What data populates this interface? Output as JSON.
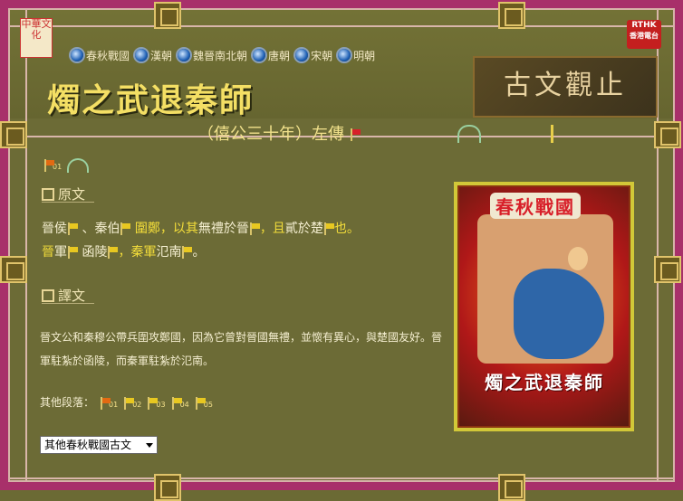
{
  "header": {
    "logo_left_text": "中華文化",
    "rthk_label": "RTHK",
    "rthk_sub": "香港電台",
    "seal_text": "古文觀止"
  },
  "nav": {
    "items": [
      {
        "label": "春秋戰國"
      },
      {
        "label": "漢朝"
      },
      {
        "label": "魏晉南北朝"
      },
      {
        "label": "唐朝"
      },
      {
        "label": "宋朝"
      },
      {
        "label": "明朝"
      }
    ]
  },
  "page": {
    "title": "燭之武退秦師",
    "subtitle": "（僖公三十年）左傳"
  },
  "audio": {
    "clip_label": "01"
  },
  "sections": {
    "original_label": "原文",
    "translation_label": "譯文"
  },
  "original_text": {
    "line1": [
      {
        "text": "晉侯",
        "hl": false
      },
      {
        "text": "、秦伯",
        "hl": false
      },
      {
        "text": "圍鄭",
        "hl": true
      },
      {
        "text": "，以其",
        "hl": true
      },
      {
        "text": "無禮於晉",
        "hl": false
      },
      {
        "text": "，且",
        "hl": true
      },
      {
        "text": "貳於楚",
        "hl": false
      },
      {
        "text": "也。",
        "hl": true
      }
    ],
    "line2": [
      {
        "text": "晉",
        "hl": true
      },
      {
        "text": "軍",
        "hl": false
      },
      {
        "text": "函陵",
        "hl": false
      },
      {
        "text": "，秦",
        "hl": true
      },
      {
        "text": "軍",
        "hl": true
      },
      {
        "text": "氾南",
        "hl": false
      },
      {
        "text": "。",
        "hl": false
      }
    ]
  },
  "translation": {
    "text": "晉文公和秦穆公帶兵圍攻鄭國，因為它曾對晉國無禮，並懷有異心，與楚國友好。晉軍駐紮於函陵，而秦軍駐紮於氾南。"
  },
  "other_paragraphs": {
    "label": "其他段落：",
    "items": [
      "01",
      "02",
      "03",
      "04",
      "05"
    ]
  },
  "select": {
    "value": "其他春秋戰國古文"
  },
  "card": {
    "top_title": "春秋戰國",
    "bottom_title": "燭之武退秦師"
  },
  "colors": {
    "background": "#6b6b35",
    "border": "#a8306a",
    "title": "#f4df64",
    "highlight": "#f4de3a",
    "nav_dot": "#1e5fb4"
  }
}
